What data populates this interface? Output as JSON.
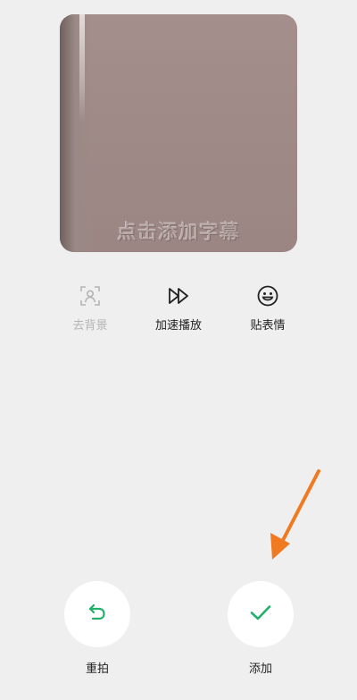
{
  "preview": {
    "subtitle_hint": "点击添加字幕"
  },
  "tools": [
    {
      "label": "去背景",
      "icon": "remove-background-icon",
      "enabled": false
    },
    {
      "label": "加速播放",
      "icon": "fast-forward-icon",
      "enabled": true
    },
    {
      "label": "贴表情",
      "icon": "emoji-icon",
      "enabled": true
    }
  ],
  "actions": {
    "retake_label": "重拍",
    "retake_icon": "retake-icon",
    "add_label": "添加",
    "add_icon": "check-icon"
  },
  "colors": {
    "accent": "#22b06a",
    "annotation_arrow": "#f07a22",
    "background": "#efefef"
  }
}
